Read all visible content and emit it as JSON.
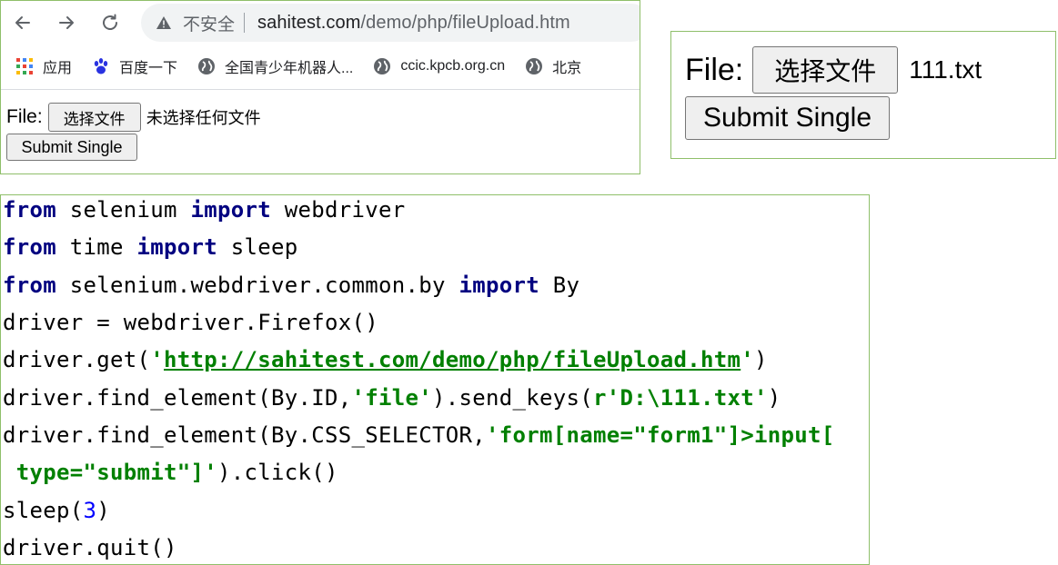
{
  "browser": {
    "security_text": "不安全",
    "url_domain": "sahitest.com",
    "url_path": "/demo/php/fileUpload.htm",
    "bookmarks": [
      "应用",
      "百度一下",
      "全国青少年机器人...",
      "ccic.kpcb.org.cn",
      "北京"
    ],
    "page": {
      "file_label": "File:",
      "choose_button": "选择文件",
      "no_file_text": "未选择任何文件",
      "submit_button": "Submit Single"
    }
  },
  "zoom": {
    "file_label": "File:",
    "choose_button": "选择文件",
    "file_name": "111.txt",
    "submit_button": "Submit Single"
  },
  "code": {
    "l1": {
      "k1": "from",
      "t1": " selenium ",
      "k2": "import",
      "t2": " webdriver"
    },
    "l2": {
      "k1": "from",
      "t1": " time ",
      "k2": "import",
      "t2": " sleep"
    },
    "l3": {
      "k1": "from",
      "t1": " selenium.webdriver.common.by ",
      "k2": "import",
      "t2": " By"
    },
    "l4": {
      "t1": "driver = webdriver.Firefox()"
    },
    "l5": {
      "t1": "driver.get(",
      "s1": "'",
      "s2": "http://sahitest.com/demo/php/fileUpload.htm",
      "s3": "'",
      "t2": ")"
    },
    "l6": {
      "t1": "driver.find_element(By.ID,",
      "s1": "'file'",
      "t2": ").send_keys(",
      "s2": "r'D:\\111.txt'",
      "t3": ")"
    },
    "l7": {
      "t1": "driver.find_element(By.CSS_SELECTOR,",
      "s1": "'form[name=\"form1\"]>input["
    },
    "l8": {
      "s1": " type=\"submit\"]'",
      "t1": ").click()"
    },
    "l9": {
      "t1": "sleep(",
      "n1": "3",
      "t2": ")"
    },
    "l10": {
      "t1": "driver.quit()"
    }
  },
  "colors": {
    "keyword": "#000080",
    "string": "#008000",
    "number": "#0000ff",
    "panel_border": "#8fbf6a"
  }
}
